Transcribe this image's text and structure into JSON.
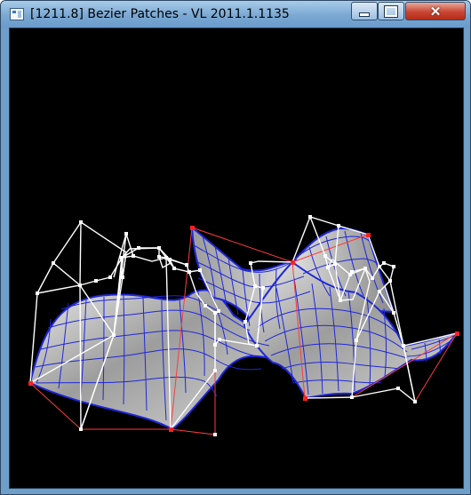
{
  "window": {
    "title": "[1211.8] Bezier Patches - VL 2011.1.1135",
    "icons": {
      "app": "app-icon",
      "minimize": "minimize-icon",
      "maximize": "maximize-icon",
      "close": "close-icon"
    }
  },
  "scene": {
    "background": "#000000",
    "surface_color": "#b8b8b8",
    "grid_color": "#1f27d8",
    "control_point_color": "#ffffff",
    "corner_point_color": "#ff2020"
  }
}
